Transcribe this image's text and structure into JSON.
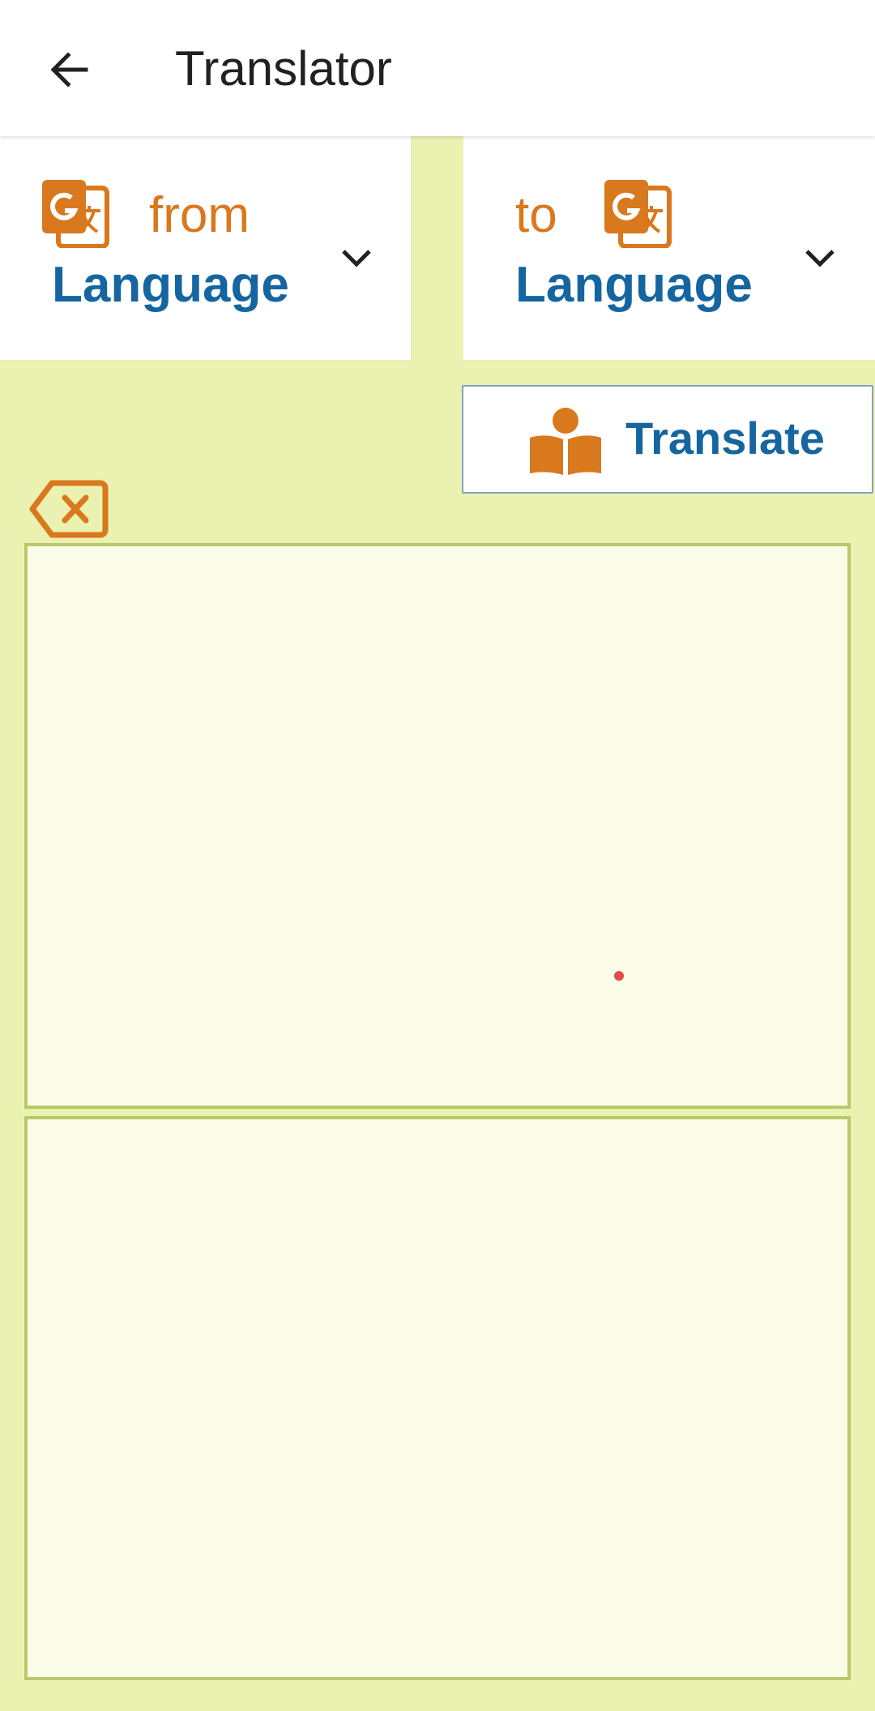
{
  "app_bar": {
    "title": "Translator",
    "back_icon": "arrow-left-icon"
  },
  "language_selector": {
    "from": {
      "caption": "from",
      "value": "Language",
      "icon": "google-translate-icon"
    },
    "to": {
      "caption": "to",
      "value": "Language",
      "icon": "google-translate-icon"
    },
    "dropdown_icon": "chevron-down-icon"
  },
  "translate_button": {
    "label": "Translate",
    "icon": "reader-book-icon"
  },
  "clear_button": {
    "icon": "backspace-clear-icon"
  },
  "input": {
    "value": "",
    "placeholder": ""
  },
  "output": {
    "value": "",
    "placeholder": ""
  },
  "colors": {
    "background": "#ebf1b0",
    "accent_orange": "#d9781c",
    "accent_blue": "#1565a0",
    "box_fill": "#fbfde9",
    "box_border": "#b7c96a"
  }
}
